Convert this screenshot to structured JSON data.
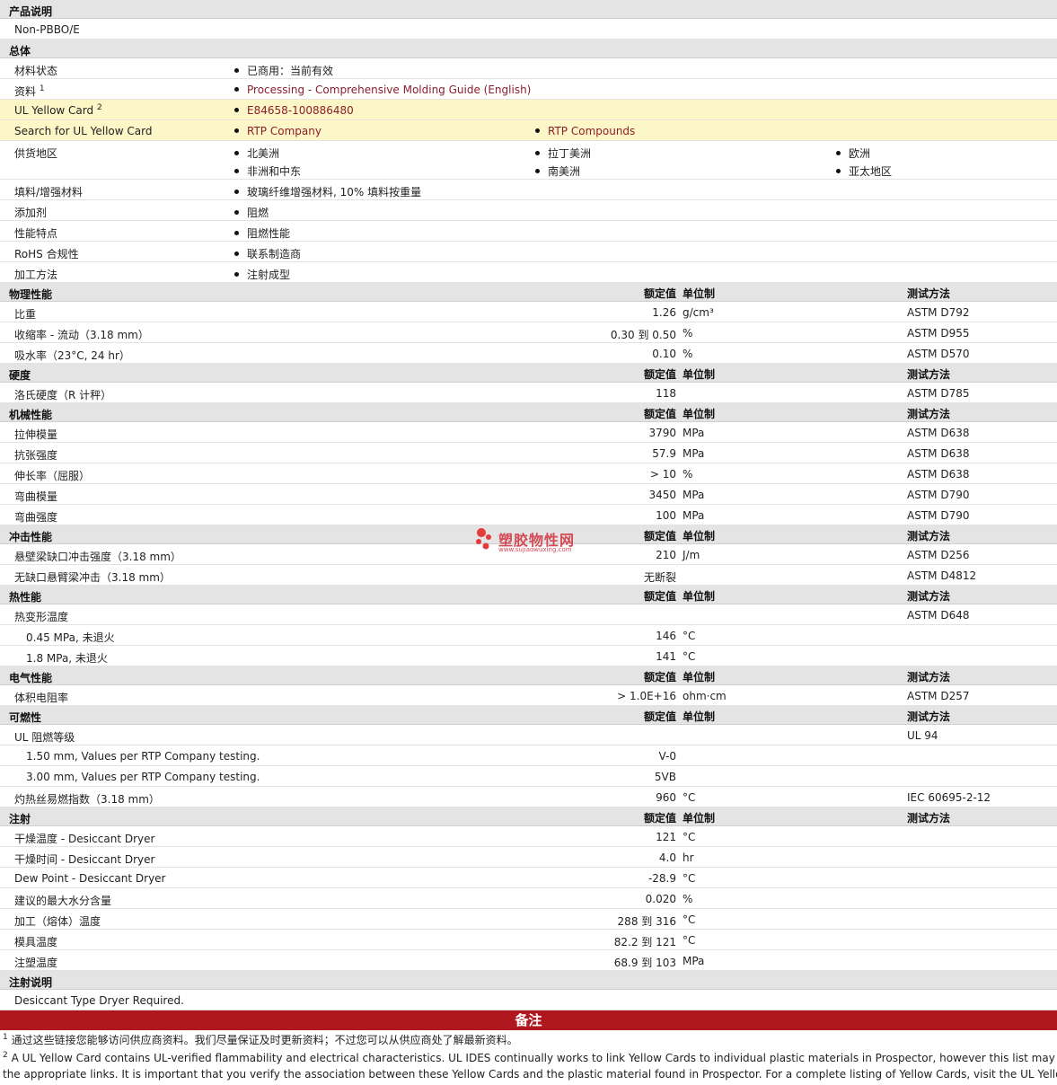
{
  "sections": {
    "desc": {
      "title": "产品说明",
      "text": "Non-PBBO/E"
    },
    "general": {
      "title": "总体",
      "status": {
        "label": "材料状态",
        "value": "已商用：当前有效"
      },
      "docs": {
        "label": "资料",
        "sup": "1",
        "value": "Processing - Comprehensive Molding Guide (English)"
      },
      "ulcard": {
        "label": "UL Yellow Card",
        "sup": "2",
        "value": "E84658-100886480"
      },
      "search": {
        "label": "Search for UL Yellow Card",
        "v1": "RTP Company",
        "v2": "RTP Compounds"
      },
      "region": {
        "label": "供货地区",
        "items": [
          "北美洲",
          "拉丁美洲",
          "欧洲",
          "非洲和中东",
          "南美洲",
          "亚太地区"
        ]
      },
      "filler": {
        "label": "填料/增强材料",
        "value": "玻璃纤维增强材料, 10% 填料按重量"
      },
      "additive": {
        "label": "添加剂",
        "value": "阻燃"
      },
      "feature": {
        "label": "性能特点",
        "value": "阻燃性能"
      },
      "rohs": {
        "label": "RoHS 合规性",
        "value": "联系制造商"
      },
      "process": {
        "label": "加工方法",
        "value": "注射成型"
      }
    },
    "col_headers": {
      "nominal": "额定值",
      "unit": "单位制",
      "test": "测试方法"
    },
    "physical": {
      "title": "物理性能",
      "rows": [
        {
          "label": "比重",
          "value": "1.26",
          "unit": "g/cm³",
          "test": "ASTM D792"
        },
        {
          "label": "收缩率 - 流动（3.18 mm）",
          "value": "0.30 到  0.50",
          "unit": "%",
          "test": "ASTM D955"
        },
        {
          "label": "吸水率（23°C, 24 hr）",
          "value": "0.10",
          "unit": "%",
          "test": "ASTM D570"
        }
      ]
    },
    "hardness": {
      "title": "硬度",
      "rows": [
        {
          "label": "洛氏硬度（R 计秤）",
          "value": "118",
          "unit": "",
          "test": "ASTM D785"
        }
      ]
    },
    "mechanical": {
      "title": "机械性能",
      "rows": [
        {
          "label": "拉伸模量",
          "value": "3790",
          "unit": "MPa",
          "test": "ASTM D638"
        },
        {
          "label": "抗张强度",
          "value": "57.9",
          "unit": "MPa",
          "test": "ASTM D638"
        },
        {
          "label": "伸长率（屈服）",
          "value": "> 10",
          "unit": "%",
          "test": "ASTM D638"
        },
        {
          "label": "弯曲模量",
          "value": "3450",
          "unit": "MPa",
          "test": "ASTM D790"
        },
        {
          "label": "弯曲强度",
          "value": "100",
          "unit": "MPa",
          "test": "ASTM D790"
        }
      ]
    },
    "impact": {
      "title": "冲击性能",
      "rows": [
        {
          "label": "悬壁梁缺口冲击强度（3.18 mm）",
          "value": "210",
          "unit": "J/m",
          "test": "ASTM D256"
        },
        {
          "label": "无缺口悬臂梁冲击（3.18 mm）",
          "value": "无断裂",
          "unit": "",
          "test": "ASTM D4812"
        }
      ]
    },
    "thermal": {
      "title": "热性能",
      "rows": [
        {
          "label": "热变形温度",
          "value": "",
          "unit": "",
          "test": "ASTM D648"
        },
        {
          "label": "0.45 MPa, 未退火",
          "value": "146",
          "unit": "°C",
          "test": "",
          "indent": true
        },
        {
          "label": "1.8 MPa, 未退火",
          "value": "141",
          "unit": "°C",
          "test": "",
          "indent": true
        }
      ]
    },
    "electrical": {
      "title": "电气性能",
      "rows": [
        {
          "label": "体积电阻率",
          "value": "> 1.0E+16",
          "unit": "ohm·cm",
          "test": "ASTM D257"
        }
      ]
    },
    "flammability": {
      "title": "可燃性",
      "rows": [
        {
          "label": "UL 阻燃等级",
          "value": "",
          "unit": "",
          "test": "UL 94"
        },
        {
          "label": "1.50 mm, Values per RTP Company testing.",
          "value": "V-0",
          "unit": "",
          "test": "",
          "indent": true
        },
        {
          "label": "3.00 mm, Values per RTP Company testing.",
          "value": "5VB",
          "unit": "",
          "test": "",
          "indent": true
        },
        {
          "label": "灼热丝易燃指数（3.18 mm）",
          "value": "960",
          "unit": "°C",
          "test": "IEC 60695-2-12"
        }
      ]
    },
    "injection": {
      "title": "注射",
      "rows": [
        {
          "label": "干燥温度 - Desiccant Dryer",
          "value": "121",
          "unit": "°C",
          "test": ""
        },
        {
          "label": "干燥时间 - Desiccant Dryer",
          "value": "4.0",
          "unit": "hr",
          "test": ""
        },
        {
          "label": "Dew Point - Desiccant Dryer",
          "value": "-28.9",
          "unit": "°C",
          "test": ""
        },
        {
          "label": "建议的最大水分含量",
          "value": "0.020",
          "unit": "%",
          "test": ""
        },
        {
          "label": "加工（熔体）温度",
          "value": "288 到  316",
          "unit": "°C",
          "test": ""
        },
        {
          "label": "模具温度",
          "value": "82.2 到  121",
          "unit": "°C",
          "test": ""
        },
        {
          "label": "注塑温度",
          "value": "68.9 到  103",
          "unit": "MPa",
          "test": ""
        }
      ]
    },
    "inj_note": {
      "title": "注射说明",
      "text": "Desiccant Type Dryer Required."
    }
  },
  "remarks": {
    "title": "备注",
    "note1_num": "1",
    "note1": "通过这些链接您能够访问供应商资料。我们尽量保证及时更新资料；不过您可以从供应商处了解最新资料。",
    "note2_num": "2",
    "note2_line1": "A UL Yellow Card contains UL-verified flammability and electrical characteristics. UL IDES continually works to link Yellow Cards to individual plastic materials in Prospector, however this list may not i",
    "note2_line2": "the appropriate links. It is important that you verify the association between these Yellow Cards and the plastic material found in Prospector. For a complete listing of Yellow Cards, visit the UL Yellow Card"
  },
  "watermark": {
    "text": "塑胶物性网",
    "url": "www.sujiaowuxing.com"
  },
  "colors": {
    "header_bg": "#e4e4e4",
    "link": "#8b1e2b",
    "highlight": "#fdf7c7",
    "banner": "#b01820"
  }
}
